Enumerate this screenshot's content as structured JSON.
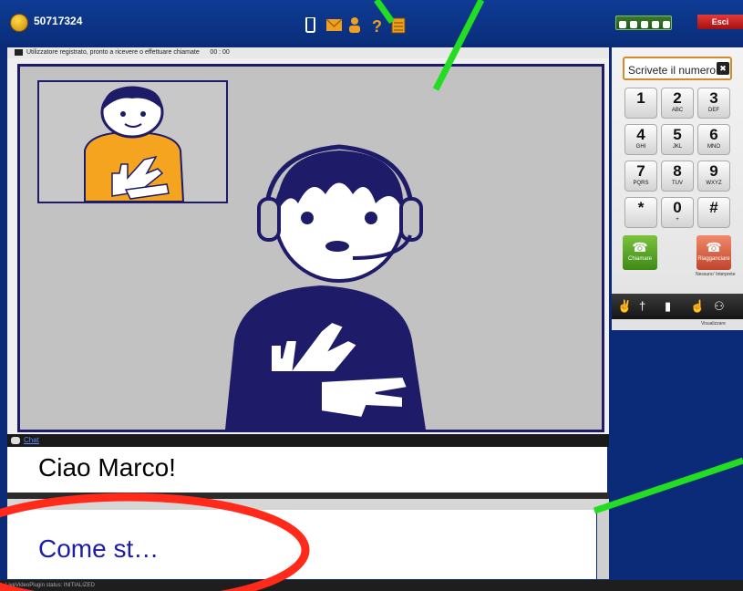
{
  "app": {
    "user_id": "50717324",
    "exit_label": "Esci"
  },
  "status_bar": {
    "text": "Utilizzatore registrato, pronto a ricevere o effettuare chiamate",
    "timer": "00 : 00"
  },
  "dialer": {
    "placeholder": "Scrivete il numero",
    "keys": [
      {
        "digit": "1",
        "letters": ""
      },
      {
        "digit": "2",
        "letters": "ABC"
      },
      {
        "digit": "3",
        "letters": "DEF"
      },
      {
        "digit": "4",
        "letters": "GHI"
      },
      {
        "digit": "5",
        "letters": "JKL"
      },
      {
        "digit": "6",
        "letters": "MNO"
      },
      {
        "digit": "7",
        "letters": "PQRS"
      },
      {
        "digit": "8",
        "letters": "TUV"
      },
      {
        "digit": "9",
        "letters": "WXYZ"
      },
      {
        "digit": "*",
        "letters": ""
      },
      {
        "digit": "0",
        "letters": "+"
      },
      {
        "digit": "#",
        "letters": ""
      }
    ],
    "call_label": "Chiamare",
    "hangup_label": "Riagganciare",
    "no_interpreter": "Nessuno' Interprete",
    "viewer_label": "Visualizzare"
  },
  "chat": {
    "tab_label": "Chat",
    "received_message": "Ciao Marco!",
    "typing_text": "Come st…"
  },
  "footer": {
    "status_text": "LiveVideoPlugin status: INITIALIZED"
  },
  "colors": {
    "frame": "#0b2a78",
    "video_border": "#1e1c69",
    "call_green": "#5aa82a",
    "hangup_red": "#d65a3a",
    "exit_red": "#c41a1a",
    "annotation_green": "#22dd22",
    "annotation_red": "#ff2a1a"
  }
}
